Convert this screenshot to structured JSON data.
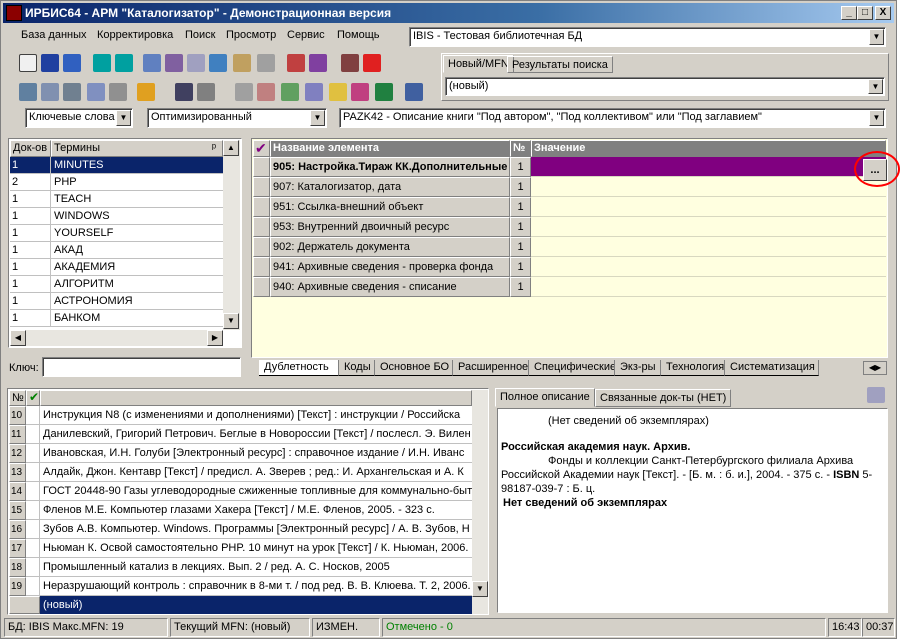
{
  "window": {
    "title": "ИРБИС64 - АРМ \"Каталогизатор\" - Демонстрационная версия",
    "min": "_",
    "max": "□",
    "close": "X"
  },
  "menu": [
    "База данных",
    "Корректировка",
    "Поиск",
    "Просмотр",
    "Сервис",
    "Помощь"
  ],
  "db_combo": "IBIS - Тестовая библиотечная БД",
  "right_tabs": {
    "tab1": "Новый/MFN",
    "tab2": "Результаты поиска",
    "value": "(новый)"
  },
  "search_bar": {
    "mode": "Ключевые слова",
    "opt": "Оптимизированный",
    "worksheet": "PAZK42 - Описание книги \"Под автором\", \"Под коллективом\" или \"Под заглавием\""
  },
  "terms": {
    "col_docs": "Док-ов",
    "col_terms": "Термины",
    "pin": "ᵖ",
    "rows": [
      {
        "n": "1",
        "t": "MINUTES"
      },
      {
        "n": "2",
        "t": "PHP"
      },
      {
        "n": "1",
        "t": "TEACH"
      },
      {
        "n": "1",
        "t": "WINDOWS"
      },
      {
        "n": "1",
        "t": "YOURSELF"
      },
      {
        "n": "1",
        "t": "АКАД"
      },
      {
        "n": "1",
        "t": "АКАДЕМИЯ"
      },
      {
        "n": "1",
        "t": "АЛГОРИТМ"
      },
      {
        "n": "1",
        "t": "АСТРОНОМИЯ"
      },
      {
        "n": "1",
        "t": "БАНКОМ"
      }
    ],
    "key_label": "Ключ:"
  },
  "fields": {
    "col_name": "Название элемента",
    "col_no": "№",
    "col_value": "Значение",
    "check": "✔",
    "ellipsis": "...",
    "rows": [
      {
        "name": "905: Настройка.Тираж КК.Дополнительные",
        "no": "1"
      },
      {
        "name": "907: Каталогизатор, дата",
        "no": "1"
      },
      {
        "name": "951: Ссылка-внешний объект",
        "no": "1"
      },
      {
        "name": "953: Внутренний двоичный ресурс",
        "no": "1"
      },
      {
        "name": "902: Держатель документа",
        "no": "1"
      },
      {
        "name": "941: Архивные сведения - проверка фонда",
        "no": "1"
      },
      {
        "name": "940: Архивные сведения - списание",
        "no": "1"
      }
    ],
    "tabs": [
      "Дублетность",
      "Коды",
      "Основное БО",
      "Расширенное",
      "Специфические",
      "Экз-ры",
      "Технология",
      "Систематизация"
    ]
  },
  "records": {
    "col_no": "№",
    "check": "✔",
    "rows": [
      {
        "n": "10",
        "t": "Инструкция N8   (с изменениями и дополнениями) [Текст] : инструкции / Российска"
      },
      {
        "n": "11",
        "t": "Данилевский, Григорий Петрович. Беглые в Новороссии [Текст] / послесл. Э. Вилен"
      },
      {
        "n": "12",
        "t": "Ивановская, И.Н. Голуби [Электронный ресурс] : справочное издание / И.Н. Иванс"
      },
      {
        "n": "13",
        "t": "Алдайк, Джон. Кентавр [Текст] / предисл. А. Зверев ; ред.: И. Архангельская и А. К"
      },
      {
        "n": "14",
        "t": "ГОСТ 20448-90 Газы углеводородные сжиженные топливные для коммунально-быт"
      },
      {
        "n": "15",
        "t": "Фленов М.Е. Компьютер глазами Хакера [Текст] / М.Е. Фленов, 2005. - 323 с."
      },
      {
        "n": "16",
        "t": "Зубов А.В. Компьютер. Windows. Программы [Электронный ресурс] / А. В. Зубов, Н"
      },
      {
        "n": "17",
        "t": "Ньюман К. Освой самостоятельно PHP. 10 минут на урок [Текст] / К. Ньюман, 2006."
      },
      {
        "n": "18",
        "t": "Промышленный катализ в лекциях. Вып. 2 / ред. А. С. Носков, 2005"
      },
      {
        "n": "19",
        "t": "Неразрушающий контроль : справочник в 8-ми т. / под ред. В. В. Клюева. Т. 2, 2006."
      }
    ],
    "new_row": "(новый)"
  },
  "description": {
    "tab1": "Полное описание",
    "tab2": "Связанные док-ты (НЕТ)",
    "line1": "(Нет сведений об экземплярах)",
    "org": "Российская академия наук. Архив.",
    "body1": "Фонды и коллекции Санкт-Петербургского филиала Архива",
    "body2": "Российской Академии наук [Текст]. - [Б. м. : б. и.], 2004. - 375 с. -",
    "isbn_label": "ISBN",
    "isbn_tail": "5-",
    "body3": "98187-039-7 : Б. ц.",
    "none": "Нет сведений об экземплярах"
  },
  "status": {
    "db": "БД: IBIS Макс.MFN: 19",
    "mfn": "Текущий MFN: (новый)",
    "changed": "ИЗМЕН.",
    "marked": "Отмечено - 0",
    "time": "16:43",
    "timer": "00:37"
  },
  "colors": {
    "selected": "#0a246a",
    "value_selected": "#800080",
    "value_bg": "#ffffe0",
    "circle": "#ff0000",
    "marked": "#008000"
  }
}
